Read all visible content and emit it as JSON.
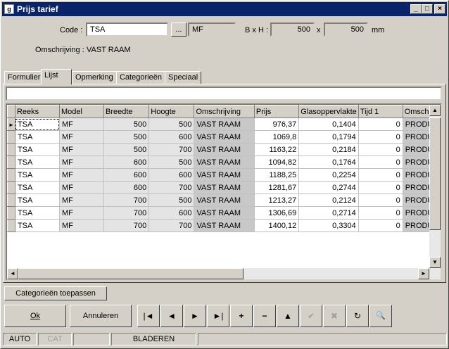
{
  "window": {
    "title": "Prijs tarief",
    "minimize": "_",
    "maximize": "□",
    "close": "×"
  },
  "header": {
    "code_label": "Code :",
    "code_value": "TSA",
    "browse_label": "...",
    "model_value": "MF",
    "bxh_label": "B x H :",
    "width_value": "500",
    "x_label": "x",
    "height_value": "500",
    "unit_label": "mm",
    "desc_label": "Omschrijving :",
    "desc_value": "VAST RAAM"
  },
  "tabs": [
    "Formulier",
    "Lijst",
    "Opmerking",
    "Categorieën",
    "Speciaal"
  ],
  "active_tab": "Lijst",
  "grid": {
    "columns": [
      "Reeks",
      "Model",
      "Breedte",
      "Hoogte",
      "Omschrijving",
      "Prijs",
      "Glasoppervlakte",
      "Tijd 1",
      "Omsch"
    ],
    "rows": [
      [
        "TSA",
        "MF",
        "500",
        "500",
        "VAST RAAM",
        "976,37",
        "0,1404",
        "0",
        "PRODU"
      ],
      [
        "TSA",
        "MF",
        "500",
        "600",
        "VAST RAAM",
        "1069,8",
        "0,1794",
        "0",
        "PRODU"
      ],
      [
        "TSA",
        "MF",
        "500",
        "700",
        "VAST RAAM",
        "1163,22",
        "0,2184",
        "0",
        "PRODU"
      ],
      [
        "TSA",
        "MF",
        "600",
        "500",
        "VAST RAAM",
        "1094,82",
        "0,1764",
        "0",
        "PRODU"
      ],
      [
        "TSA",
        "MF",
        "600",
        "600",
        "VAST RAAM",
        "1188,25",
        "0,2254",
        "0",
        "PRODU"
      ],
      [
        "TSA",
        "MF",
        "600",
        "700",
        "VAST RAAM",
        "1281,67",
        "0,2744",
        "0",
        "PRODU"
      ],
      [
        "TSA",
        "MF",
        "700",
        "500",
        "VAST RAAM",
        "1213,27",
        "0,2124",
        "0",
        "PRODU"
      ],
      [
        "TSA",
        "MF",
        "700",
        "600",
        "VAST RAAM",
        "1306,69",
        "0,2714",
        "0",
        "PRODU"
      ],
      [
        "TSA",
        "MF",
        "700",
        "700",
        "VAST RAAM",
        "1400,12",
        "0,3304",
        "0",
        "PRODU"
      ]
    ]
  },
  "buttons": {
    "apply_categories": "Categorieën toepassen",
    "ok": "Ok",
    "cancel": "Annuleren"
  },
  "nav": {
    "first": "|◄",
    "prev": "◄",
    "next": "►",
    "last": "►|",
    "add": "+",
    "delete": "−",
    "up": "▲",
    "confirm": "✔",
    "cancel_edit": "✖",
    "refresh": "↻",
    "find": "🔍"
  },
  "status": [
    "AUTO",
    "CAT",
    "",
    "BLADEREN",
    ""
  ]
}
